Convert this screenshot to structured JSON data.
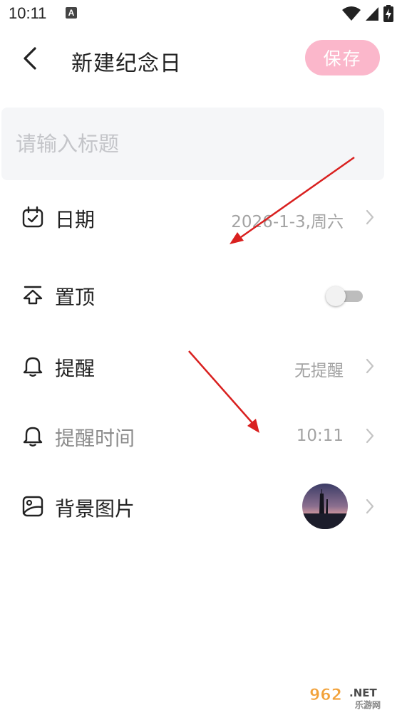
{
  "status_bar": {
    "time": "10:11",
    "notification_glyph": "A",
    "icons": [
      "wifi-icon",
      "signal-icon",
      "battery-charging-icon"
    ]
  },
  "header": {
    "back_icon": "chevron-left-icon",
    "title": "新建纪念日",
    "save_label": "保存",
    "save_color": "#fbb7cb"
  },
  "title_input": {
    "placeholder": "请输入标题",
    "value": ""
  },
  "rows": {
    "date": {
      "icon": "calendar-check-icon",
      "label": "日期",
      "value": "2026-1-3,周六"
    },
    "pin_top": {
      "icon": "pin-top-icon",
      "label": "置顶",
      "toggle_on": false
    },
    "reminder": {
      "icon": "bell-icon",
      "label": "提醒",
      "value": "无提醒"
    },
    "reminder_time": {
      "icon": "bell-icon",
      "label": "提醒时间",
      "value": "10:11",
      "disabled": true
    },
    "background": {
      "icon": "image-icon",
      "label": "背景图片"
    }
  },
  "colors": {
    "accent_pink": "#fbb7cb",
    "input_bg": "#f5f6f8",
    "annotation_red": "#d9201f"
  },
  "watermark": {
    "brand": "962",
    "suffix": ".NET",
    "site": "乐游网"
  }
}
